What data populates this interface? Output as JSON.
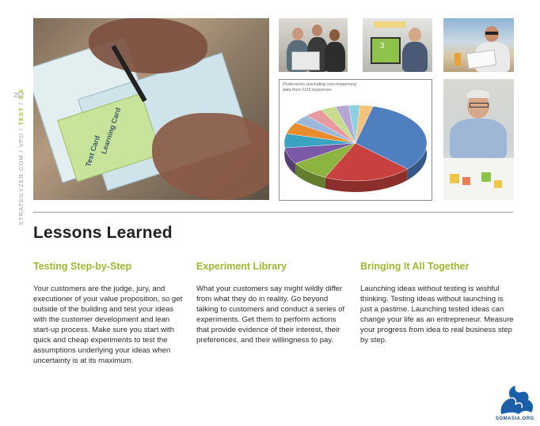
{
  "page": {
    "number": "252"
  },
  "sidebar": {
    "prefix": "STRATEGYZER.COM / VPD / ",
    "section": "TEST",
    "sep": " / ",
    "chapter": "3.4"
  },
  "main_photo": {
    "card_label_1": "Test Card",
    "card_label_2": "Learning Card"
  },
  "photo_screen": {
    "label": "3"
  },
  "chart": {
    "caption_line1": "Professions (excluding non-responses)",
    "caption_line2": "data from 1119 responses"
  },
  "chart_data": {
    "type": "pie",
    "title": "Professions (excluding non-responses)",
    "subtitle": "data from 1119 responses",
    "slices": [
      {
        "value": 33.0,
        "color": "#4f7fc1"
      },
      {
        "value": 20.0,
        "color": "#c8413f"
      },
      {
        "value": 9.0,
        "color": "#8db440"
      },
      {
        "value": 7.0,
        "color": "#7a5aa6"
      },
      {
        "value": 6.0,
        "color": "#3aa3c2"
      },
      {
        "value": 5.0,
        "color": "#e98c2e"
      },
      {
        "value": 4.0,
        "color": "#9cb8dd"
      },
      {
        "value": 4.0,
        "color": "#e79ba0"
      },
      {
        "value": 3.5,
        "color": "#c7dc8f"
      },
      {
        "value": 3.0,
        "color": "#b7a6d2"
      },
      {
        "value": 2.5,
        "color": "#8ed0e3"
      },
      {
        "value": 3.0,
        "color": "#f5c27a"
      }
    ]
  },
  "heading": {
    "title": "Lessons Learned"
  },
  "columns": [
    {
      "title": "Testing Step-by-Step",
      "body": "Your customers are the judge, jury, and executioner of your value proposition, so get outside of the building and test your ideas with the customer development and lean start-up process. Make sure you start with quick and cheap experiments to test the assumptions underlying your ideas when uncertainty is at its maximum."
    },
    {
      "title": "Experiment Library",
      "body": "What your customers say might wildly differ from what they do in reality. Go beyond talking to customers and conduct a series of experiments. Get them to perform actions that provide evidence of their interest, their preferences, and their willingness to pay."
    },
    {
      "title": "Bringing It All Together",
      "body": "Launching ideas without testing is wishful thinking. Testing ideas without launching is just a pastime. Launching tested ideas can change your life as an entrepreneur. Measure your progress from idea to real business step by step."
    }
  ],
  "watermark": {
    "text": "SOMASIA.ORG",
    "color": "#1b5fa8"
  }
}
